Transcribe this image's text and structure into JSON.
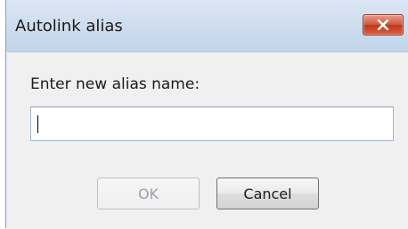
{
  "window": {
    "title": "Autolink alias",
    "close_icon": "close-icon"
  },
  "form": {
    "prompt_label": "Enter new alias name:",
    "alias_value": "",
    "alias_placeholder": ""
  },
  "buttons": {
    "ok_label": "OK",
    "ok_enabled": false,
    "cancel_label": "Cancel"
  },
  "colors": {
    "close_button": "#c9422a",
    "title_bar": "#cddcee",
    "dialog_background": "#f0f0f0",
    "disabled_text": "#9aa2ab"
  }
}
